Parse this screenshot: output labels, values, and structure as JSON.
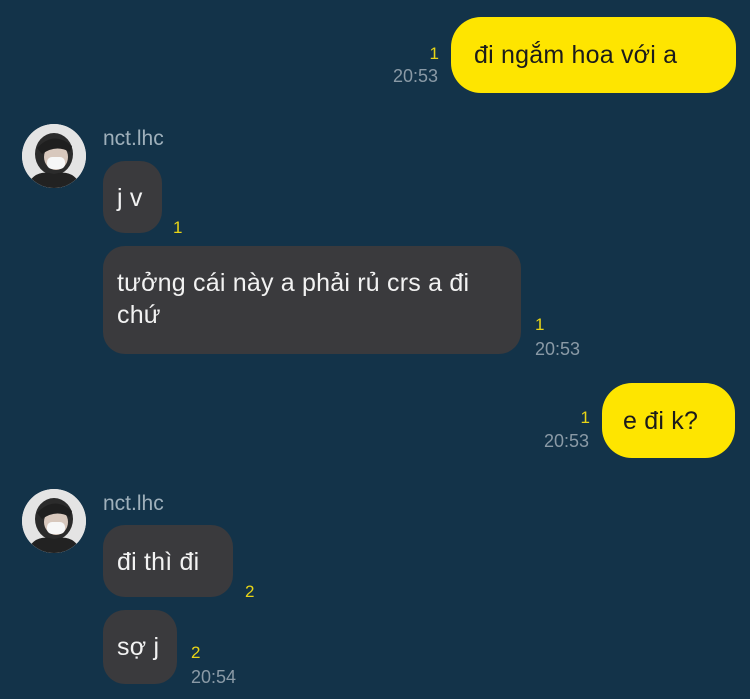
{
  "messages": [
    {
      "text": "đi ngắm hoa với a",
      "unread": "1",
      "time": "20:53"
    },
    {
      "text": "j v",
      "unread": "1"
    },
    {
      "text": "tưởng cái này a phải rủ crs a đi chứ",
      "unread": "1",
      "time": "20:53"
    },
    {
      "text": "e đi k?",
      "unread": "1",
      "time": "20:53"
    },
    {
      "text": "đi thì đi",
      "unread": "2"
    },
    {
      "text": "sợ j",
      "unread": "2",
      "time": "20:54"
    }
  ],
  "senders": [
    {
      "name": "nct.lhc"
    },
    {
      "name": "nct.lhc"
    }
  ],
  "colors": {
    "background": "#133349",
    "outgoing_bubble": "#fee500",
    "incoming_bubble": "#3a3a3d",
    "unread_count": "#e8d416",
    "timestamp": "#8a9aa6"
  }
}
